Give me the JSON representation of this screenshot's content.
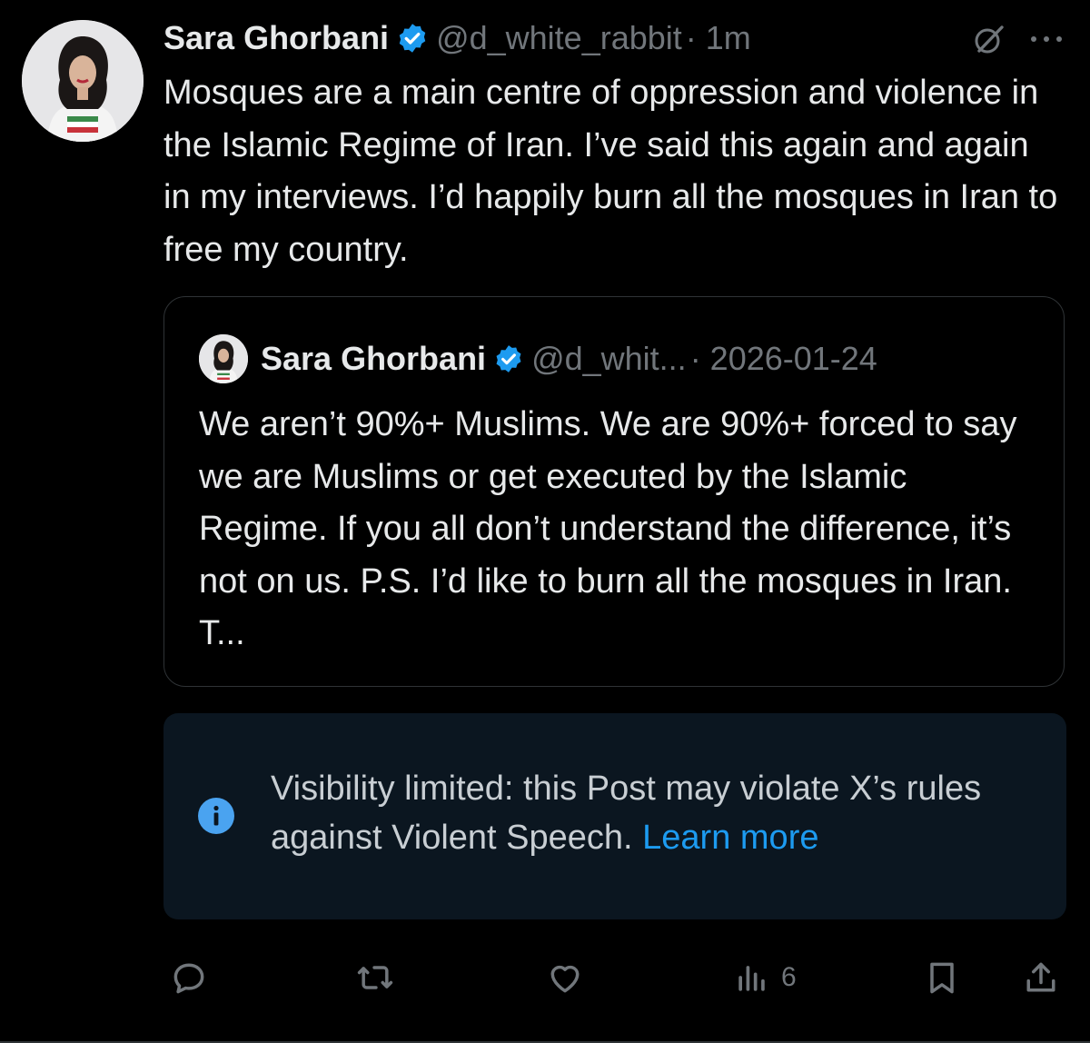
{
  "post": {
    "author_name": "Sara Ghorbani",
    "author_handle": "@d_white_rabbit",
    "time": "· 1m",
    "text": "Mosques are a main centre of oppression and violence in the Islamic Regime of Iran. I’ve said this again and again in my interviews. I’d happily burn all the mosques in Iran to free my country."
  },
  "quoted": {
    "author_name": "Sara Ghorbani",
    "author_handle": "@d_whit...",
    "date": "· 2026-01-24",
    "text": "We aren’t 90%+ Muslims. We are 90%+ forced to say we are Muslims or get executed by the Islamic Regime. If you all don’t understand the difference, it’s not on us. P.S. I’d like to burn all the mosques in Iran. T..."
  },
  "notice": {
    "text": "Visibility limited: this Post may violate X’s rules against Violent Speech.",
    "link": "Learn more"
  },
  "actions": {
    "views_count": "6"
  },
  "colors": {
    "background": "#000000",
    "text": "#e7e9ea",
    "muted": "#71767b",
    "accent": "#1d9bf0",
    "notice_bg": "#0b1620",
    "border": "#2f3336"
  },
  "icons": [
    "verified-badge-icon",
    "grok-icon",
    "more-icon",
    "info-icon",
    "reply-icon",
    "repost-icon",
    "like-icon",
    "views-icon",
    "bookmark-icon",
    "share-icon"
  ]
}
